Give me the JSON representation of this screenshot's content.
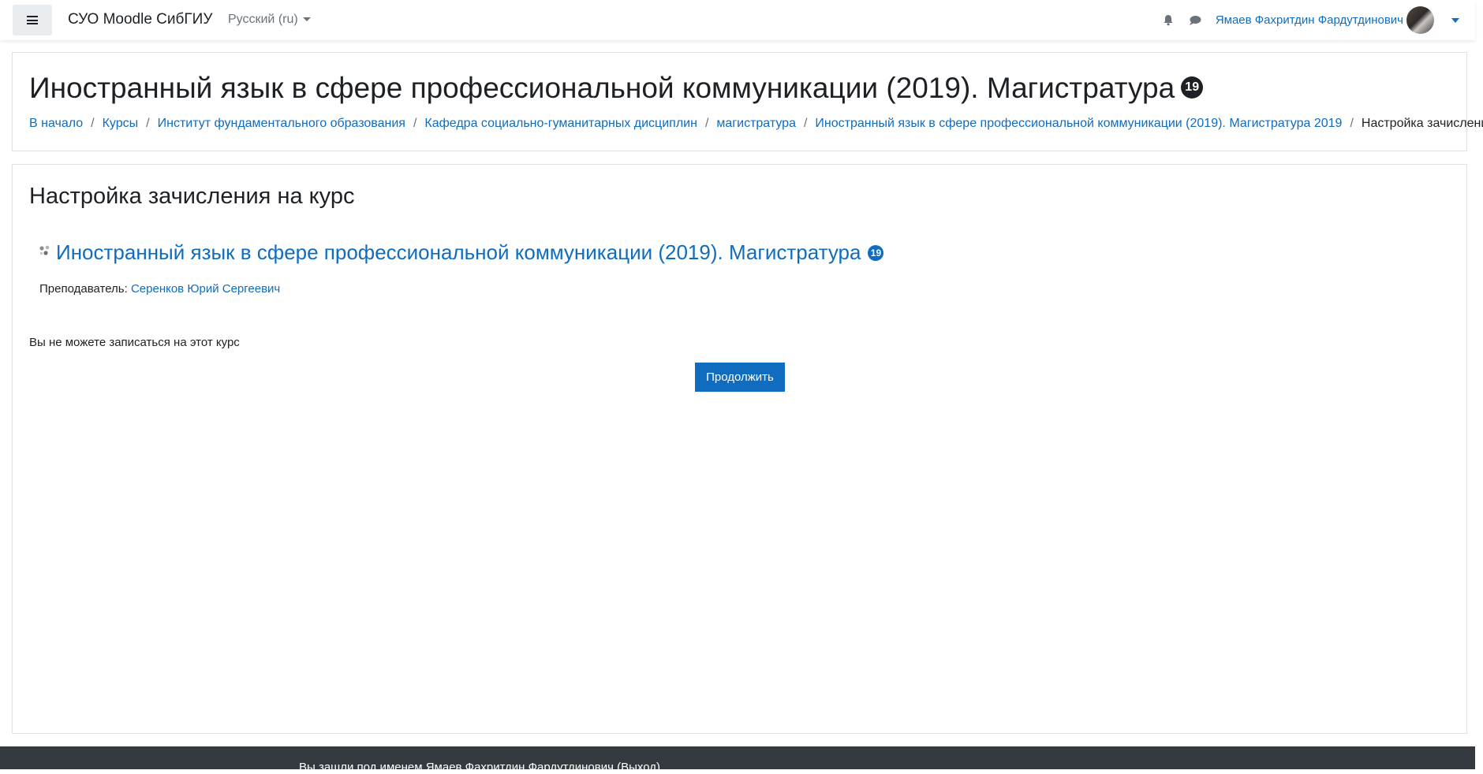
{
  "navbar": {
    "menu_icon": "hamburger-icon",
    "brand": "СУО Moodle СибГИУ",
    "language": "Русский (ru)",
    "notifications_icon": "bell-icon",
    "messages_icon": "chat-bubble-icon",
    "user_name": "Ямаев Фахритдин Фардутдинович",
    "user_menu_icon": "caret-down-icon"
  },
  "header": {
    "title": "Иностранный язык в сфере профессиональной коммуникации (2019). Магистратура",
    "badge": "19",
    "breadcrumbs": [
      "В начало",
      "Курсы",
      "Институт фундаментального образования",
      "Кафедра социально-гуманитарных дисциплин",
      "магистратура",
      "Иностранный язык в сфере профессиональной коммуникации (2019). Магистратура 2019"
    ],
    "breadcrumb_current": "Настройка зачисления на курс"
  },
  "main": {
    "section_title": "Настройка зачисления на курс",
    "course_icon": "course-icon",
    "course_name": "Иностранный язык в сфере профессиональной коммуникации (2019). Магистратура",
    "course_badge": "19",
    "teacher_label": "Преподаватель:",
    "teacher_name": "Серенков Юрий Сергеевич",
    "notice": "Вы не можете записаться на этот курс",
    "continue_button": "Продолжить"
  },
  "footer": {
    "logged_in_prefix": "Вы зашли под именем",
    "user_name": "Ямаев Фахритдин Фардутдинович",
    "logout": "(Выход)"
  },
  "colors": {
    "link": "#0f6cbf",
    "text": "#1d2125",
    "footer_bg": "#343a40",
    "button_bg": "#0f6cbf"
  }
}
